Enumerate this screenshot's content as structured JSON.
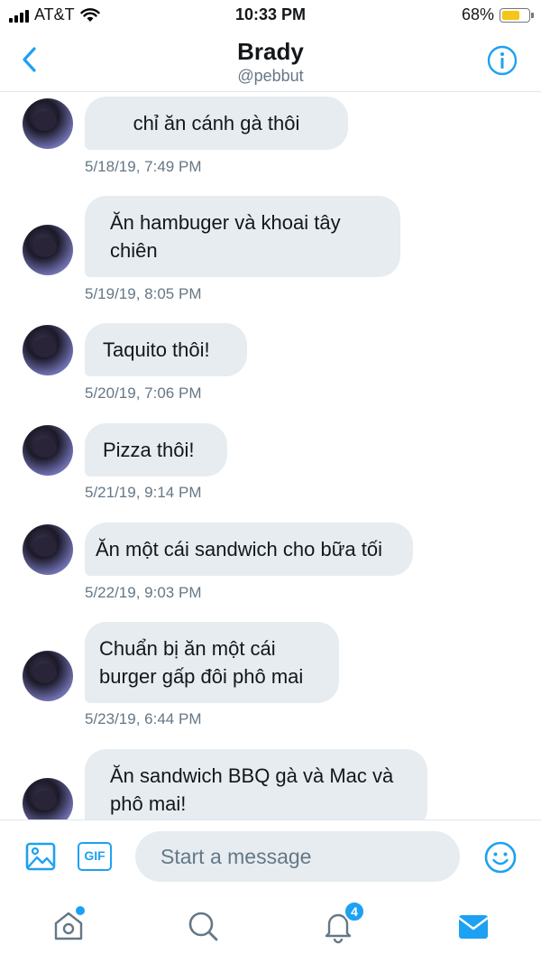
{
  "status_bar": {
    "carrier": "AT&T",
    "time": "10:33 PM",
    "battery_percent": "68%",
    "battery_level": 0.68
  },
  "header": {
    "name": "Brady",
    "handle": "@pebbut",
    "back_icon": "chevron-left-icon",
    "info_icon": "info-icon"
  },
  "messages": [
    {
      "text": "chỉ ăn cánh gà thôi",
      "timestamp": "5/18/19, 7:49 PM"
    },
    {
      "text": "Ăn hambuger và khoai tây chiên",
      "timestamp": "5/19/19, 8:05 PM"
    },
    {
      "text": "Taquito thôi!",
      "timestamp": "5/20/19, 7:06 PM"
    },
    {
      "text": "Pizza thôi!",
      "timestamp": "5/21/19, 9:14 PM"
    },
    {
      "text": "Ăn một cái sandwich cho bữa tối",
      "timestamp": "5/22/19, 9:03 PM"
    },
    {
      "text": "Chuẩn bị ăn một cái burger gấp đôi phô mai",
      "timestamp": "5/23/19, 6:44 PM"
    },
    {
      "text": "Ăn sandwich BBQ gà và Mac và phô mai!",
      "timestamp": ""
    }
  ],
  "composer": {
    "placeholder": "Start a message",
    "gif_label": "GIF",
    "media_icon": "image-icon",
    "emoji_icon": "emoji-icon"
  },
  "tabbar": {
    "notifications_count": "4",
    "icons": [
      "home-icon",
      "search-icon",
      "bell-icon",
      "mail-icon"
    ]
  },
  "colors": {
    "accent": "#1da1f2",
    "bubble": "#e6ecf0",
    "secondary_text": "#657786"
  }
}
